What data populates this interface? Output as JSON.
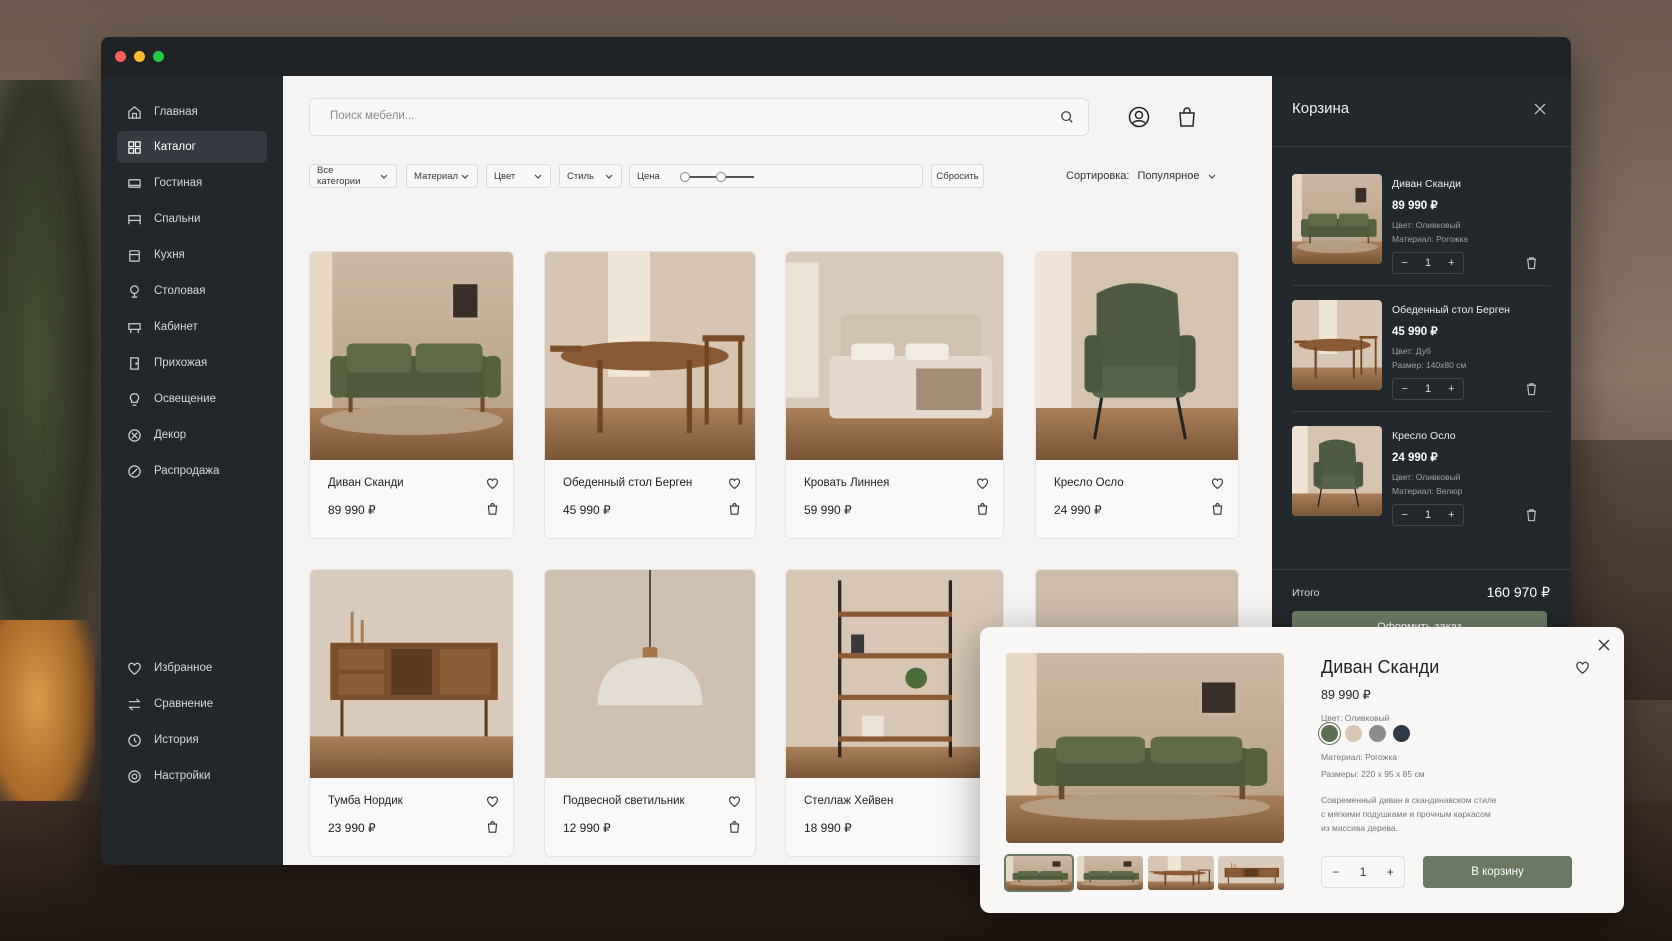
{
  "window": {
    "dots": [
      "#ff5f57",
      "#febc2e",
      "#28c840"
    ]
  },
  "sidebar": {
    "items": [
      {
        "label": "Главная",
        "icon": "home-icon"
      },
      {
        "label": "Каталог",
        "icon": "grid-icon",
        "active": true
      },
      {
        "label": "Гостиная",
        "icon": "sofa-icon"
      },
      {
        "label": "Спальни",
        "icon": "bed-icon"
      },
      {
        "label": "Кухня",
        "icon": "kitchen-icon"
      },
      {
        "label": "Столовая",
        "icon": "dining-icon"
      },
      {
        "label": "Кабинет",
        "icon": "desk-icon"
      },
      {
        "label": "Прихожая",
        "icon": "door-icon"
      },
      {
        "label": "Освещение",
        "icon": "lamp-icon"
      },
      {
        "label": "Декор",
        "icon": "decor-icon"
      },
      {
        "label": "Распродажа",
        "icon": "sale-icon"
      }
    ],
    "bottom": [
      {
        "label": "Избранное",
        "icon": "heart-icon"
      },
      {
        "label": "Сравнение",
        "icon": "compare-icon"
      },
      {
        "label": "История",
        "icon": "history-icon"
      },
      {
        "label": "Настройки",
        "icon": "settings-icon"
      }
    ]
  },
  "search": {
    "placeholder": "Поиск мебели..."
  },
  "filters": {
    "category": "Все категории",
    "material": "Материал",
    "color": "Цвет",
    "style": "Стиль",
    "price": "Цена",
    "reset": "Сбросить",
    "sort_label": "Сортировка:",
    "sort_value": "Популярное"
  },
  "products": [
    {
      "name": "Диван Сканди",
      "price": "89 990 ₽"
    },
    {
      "name": "Обеденный стол Берген",
      "price": "45 990 ₽"
    },
    {
      "name": "Кровать Линнея",
      "price": "59 990 ₽"
    },
    {
      "name": "Кресло Осло",
      "price": "24 990 ₽"
    },
    {
      "name": "Тумба Нордик",
      "price": "23 990 ₽"
    },
    {
      "name": "Подвесной светильник",
      "price": "12 990 ₽"
    },
    {
      "name": "Стеллаж Хейвен",
      "price": "18 990 ₽"
    },
    {
      "name": "",
      "price": ""
    }
  ],
  "cart": {
    "title": "Корзина",
    "items": [
      {
        "name": "Диван Сканди",
        "price": "89 990 ₽",
        "meta1": "Цвет: Оливковый",
        "meta2": "Материал: Рогожка",
        "qty": "1"
      },
      {
        "name": "Обеденный стол Берген",
        "price": "45 990 ₽",
        "meta1": "Цвет: Дуб",
        "meta2": "Размер: 140х80 см",
        "qty": "1"
      },
      {
        "name": "Кресло Осло",
        "price": "24 990 ₽",
        "meta1": "Цвет: Оливковый",
        "meta2": "Материал: Велюр",
        "qty": "1"
      }
    ],
    "total_label": "Итого",
    "total_value": "160 970 ₽",
    "checkout": "Оформить заказ"
  },
  "modal": {
    "title": "Диван Сканди",
    "price": "89 990 ₽",
    "color_label": "Цвет: Оливковый",
    "swatches": [
      "#5f6f53",
      "#d9c7b3",
      "#8c8c8c",
      "#2e3a48"
    ],
    "material": "Материал: Рогожка",
    "size": "Размеры: 220 x 95 x 85 см",
    "desc1": "Современный диван в скандинавском стиле",
    "desc2": "с мягкими подушками и прочным каркасом",
    "desc3": "из массива дерева.",
    "qty": "1",
    "add": "В корзину"
  },
  "colors": {
    "accent": "#6b7962",
    "dark": "#22272b"
  }
}
